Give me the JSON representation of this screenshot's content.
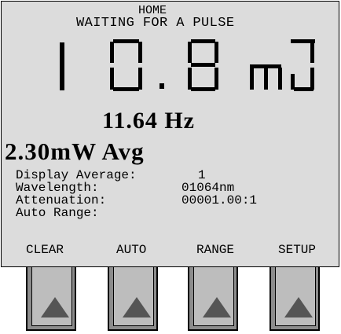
{
  "header": {
    "mode": "HOME",
    "status": "WAITING FOR A PULSE"
  },
  "reading": {
    "digit_1": "1",
    "digit_2": "0",
    "decimal": ".",
    "digit_3": "8",
    "unit": "mJ"
  },
  "frequency": "11.64 Hz",
  "power": "2.30mW Avg",
  "info": {
    "display_average_label": "Display Average:",
    "display_average_value": "1",
    "wavelength_label": "Wavelength:",
    "wavelength_value": "01064nm",
    "attenuation_label": "Attenuation:",
    "attenuation_value": "00001.00:1",
    "auto_range_label": "Auto Range:"
  },
  "softkeys": [
    "CLEAR",
    "AUTO",
    "RANGE",
    "SETUP"
  ],
  "colors": {
    "screen_bg": "#dcdcdc",
    "button_outer": "#8c8c8c",
    "button_inner": "#bdbdbd",
    "arrow": "#555555"
  },
  "icons": {
    "button_arrow": "up-triangle-icon"
  }
}
